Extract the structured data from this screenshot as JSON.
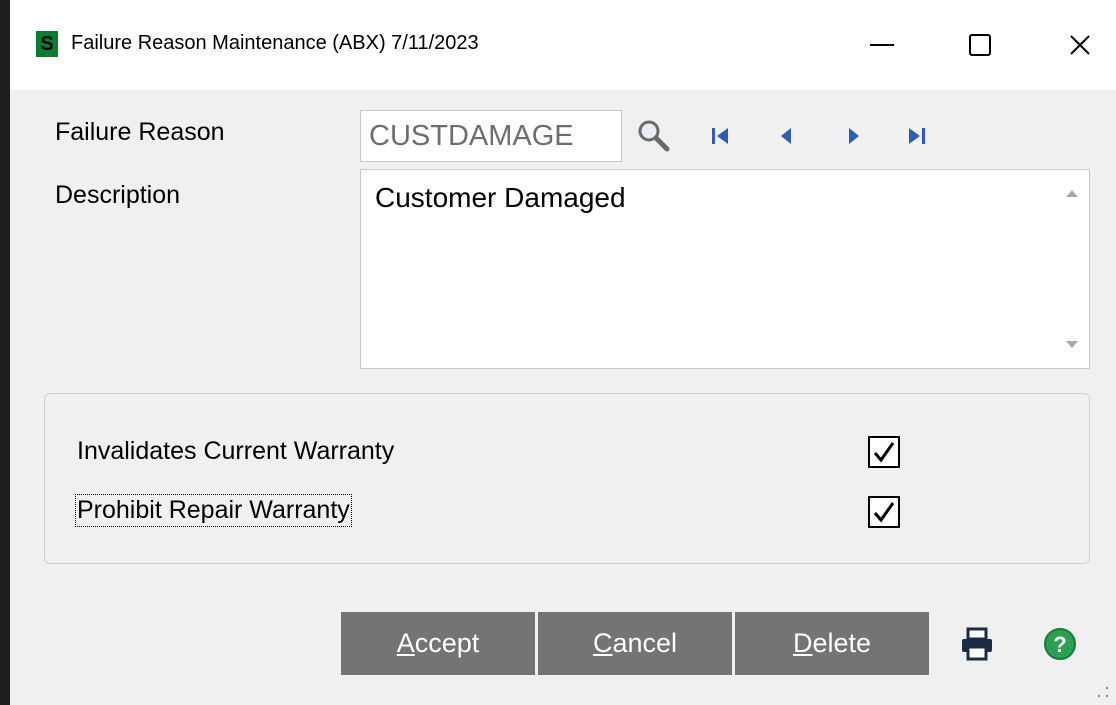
{
  "window": {
    "title": "Failure Reason Maintenance (ABX) 7/11/2023",
    "logo_letter": "S",
    "controls": {
      "minimize": "—",
      "maximize": "☐",
      "close": "✕"
    }
  },
  "form": {
    "failure_reason_label": "Failure Reason",
    "failure_reason_value": "CUSTDAMAGE",
    "description_label": "Description",
    "description_value": "Customer Damaged"
  },
  "options": {
    "invalidates_label": "Invalidates Current Warranty",
    "invalidates_checked": true,
    "prohibit_label": "Prohibit Repair Warranty",
    "prohibit_checked": true
  },
  "buttons": {
    "accept": {
      "key": "A",
      "rest": "ccept"
    },
    "cancel": {
      "key": "C",
      "rest": "ancel"
    },
    "delete": {
      "key": "D",
      "rest": "elete"
    }
  },
  "icons": {
    "lookup": "search-icon",
    "first": "first-record-icon",
    "previous": "previous-record-icon",
    "next": "next-record-icon",
    "last": "last-record-icon",
    "print": "printer-icon",
    "help": "help-icon"
  },
  "colors": {
    "nav_arrows": "#2f5cb8",
    "button_bg": "#747474",
    "logo_green": "#0a7d32",
    "help_green": "#2aa050"
  }
}
